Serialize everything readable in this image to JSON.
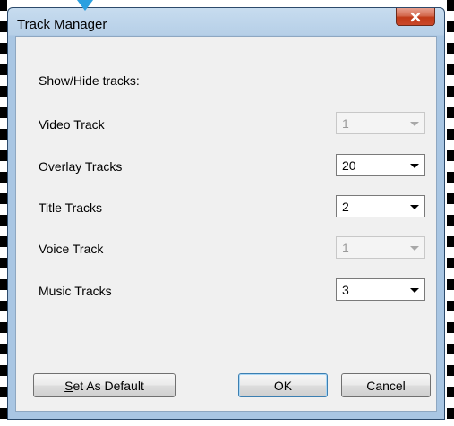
{
  "window": {
    "title": "Track Manager"
  },
  "dialog": {
    "heading": "Show/Hide tracks:",
    "tracks": [
      {
        "label": "Video Track",
        "value": "1",
        "enabled": false
      },
      {
        "label": "Overlay Tracks",
        "value": "20",
        "enabled": true
      },
      {
        "label": "Title Tracks",
        "value": "2",
        "enabled": true
      },
      {
        "label": "Voice Track",
        "value": "1",
        "enabled": false
      },
      {
        "label": "Music Tracks",
        "value": "3",
        "enabled": true
      }
    ]
  },
  "buttons": {
    "set_default_mnemonic": "S",
    "set_default_rest": "et As Default",
    "ok": "OK",
    "cancel": "Cancel"
  },
  "icons": {
    "close": "close-icon",
    "pointer": "pointer-arrow-icon"
  },
  "colors": {
    "titlebar": "#b6cfe7",
    "close_button": "#c13a18",
    "dialog_bg": "#f0f0f0",
    "pointer": "#2aa0e0"
  }
}
